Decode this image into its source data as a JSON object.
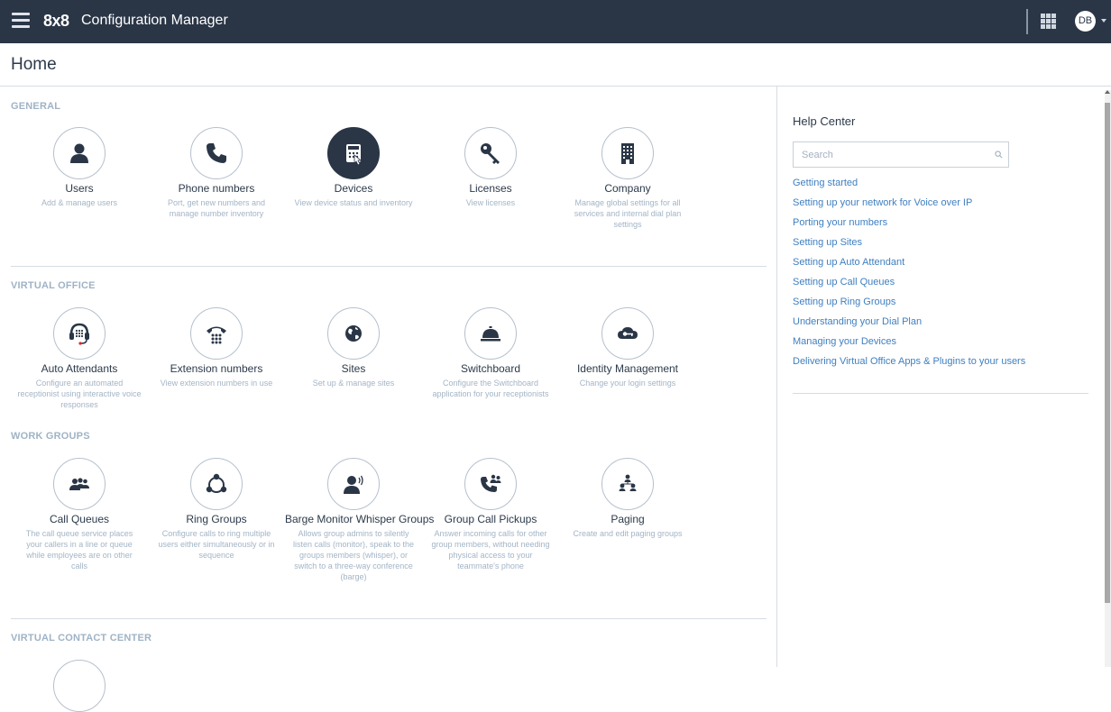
{
  "topbar": {
    "logo": "8x8",
    "title": "Configuration Manager",
    "avatar": "DB"
  },
  "page": {
    "title": "Home"
  },
  "sections": {
    "general": {
      "title": "GENERAL",
      "tiles": [
        {
          "label": "Users",
          "desc": "Add & manage users",
          "icon": "user-icon"
        },
        {
          "label": "Phone numbers",
          "desc": "Port, get new numbers and manage number inventory",
          "icon": "phone-icon"
        },
        {
          "label": "Devices",
          "desc": "View device status and inventory",
          "icon": "desk-phone-icon"
        },
        {
          "label": "Licenses",
          "desc": "View licenses",
          "icon": "key-icon"
        },
        {
          "label": "Company",
          "desc": "Manage global settings for all services and internal dial plan settings",
          "icon": "building-icon"
        }
      ]
    },
    "virtual_office": {
      "title": "VIRTUAL OFFICE",
      "tiles": [
        {
          "label": "Auto Attendants",
          "desc": "Configure an automated receptionist using interactive voice responses",
          "icon": "headset-icon"
        },
        {
          "label": "Extension numbers",
          "desc": "View extension numbers in use",
          "icon": "dialpad-icon"
        },
        {
          "label": "Sites",
          "desc": "Set up & manage sites",
          "icon": "globe-icon"
        },
        {
          "label": "Switchboard",
          "desc": "Configure the Switchboard application for your receptionists",
          "icon": "bell-icon"
        },
        {
          "label": "Identity Management",
          "desc": "Change your login settings",
          "icon": "identity-icon"
        }
      ]
    },
    "work_groups": {
      "title": "WORK GROUPS",
      "tiles": [
        {
          "label": "Call Queues",
          "desc": "The call queue service places your callers in a line or queue while employees are on other calls",
          "icon": "queue-icon"
        },
        {
          "label": "Ring Groups",
          "desc": "Configure calls to ring multiple users either simultaneously or in sequence",
          "icon": "ring-group-icon"
        },
        {
          "label": "Barge Monitor Whisper Groups",
          "desc": "Allows group admins to silently listen calls (monitor), speak to the groups members (whisper), or switch to a three-way conference (barge)",
          "icon": "monitor-icon"
        },
        {
          "label": "Group Call Pickups",
          "desc": "Answer incoming calls for other group members, without needing physical access to your teammate's phone",
          "icon": "pickup-icon"
        },
        {
          "label": "Paging",
          "desc": "Create and edit paging groups",
          "icon": "paging-icon"
        }
      ]
    },
    "contact_center": {
      "title": "VIRTUAL CONTACT CENTER"
    }
  },
  "help": {
    "title": "Help Center",
    "search_placeholder": "Search",
    "links": [
      "Getting started",
      "Setting up your network for Voice over IP",
      "Porting your numbers",
      "Setting up Sites",
      "Setting up Auto Attendant",
      "Setting up Call Queues",
      "Setting up Ring Groups",
      "Understanding your Dial Plan",
      "Managing your Devices",
      "Delivering Virtual Office Apps & Plugins to your users"
    ]
  },
  "colors": {
    "topbar": "#2a3646",
    "accent_link": "#3f7fc0",
    "section_title": "#9fb3c6",
    "icon": "#2a3646"
  }
}
